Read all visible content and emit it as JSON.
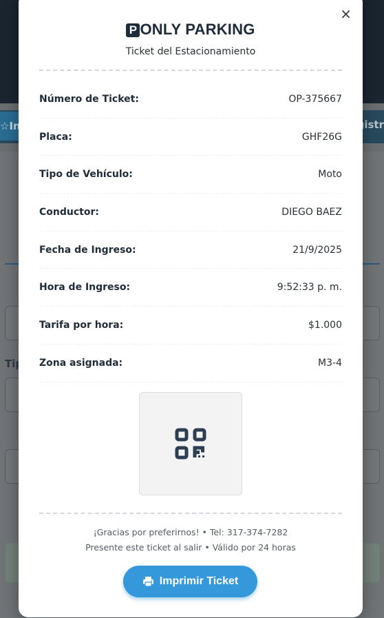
{
  "background": {
    "nav_left_label": "In",
    "nav_right_label": "gistr",
    "label_tipo": "Tip"
  },
  "modal": {
    "close_glyph": "×",
    "brand_letter": "P",
    "brand_name": "ONLY PARKING",
    "subtitle": "Ticket del Estacionamiento",
    "rows": [
      {
        "label": "Número de Ticket:",
        "value": "OP-375667"
      },
      {
        "label": "Placa:",
        "value": "GHF26G"
      },
      {
        "label": "Tipo de Vehículo:",
        "value": "Moto"
      },
      {
        "label": "Conductor:",
        "value": "DIEGO BAEZ"
      },
      {
        "label": "Fecha de Ingreso:",
        "value": "21/9/2025"
      },
      {
        "label": "Hora de Ingreso:",
        "value": "9:52:33 p. m."
      },
      {
        "label": "Tarifa por hora:",
        "value": "$1.000"
      },
      {
        "label": "Zona asignada:",
        "value": "M3-4"
      }
    ],
    "qr_icon": "qrcode-icon",
    "footer_line1": "¡Gracias por preferirnos! • Tel: 317-374-7282",
    "footer_line2": "Presente este ticket al salir • Válido por 24 horas",
    "print_label": "Imprimir Ticket",
    "print_icon": "printer-icon"
  },
  "colors": {
    "primary": "#3498db",
    "dark": "#1e2b3a"
  }
}
